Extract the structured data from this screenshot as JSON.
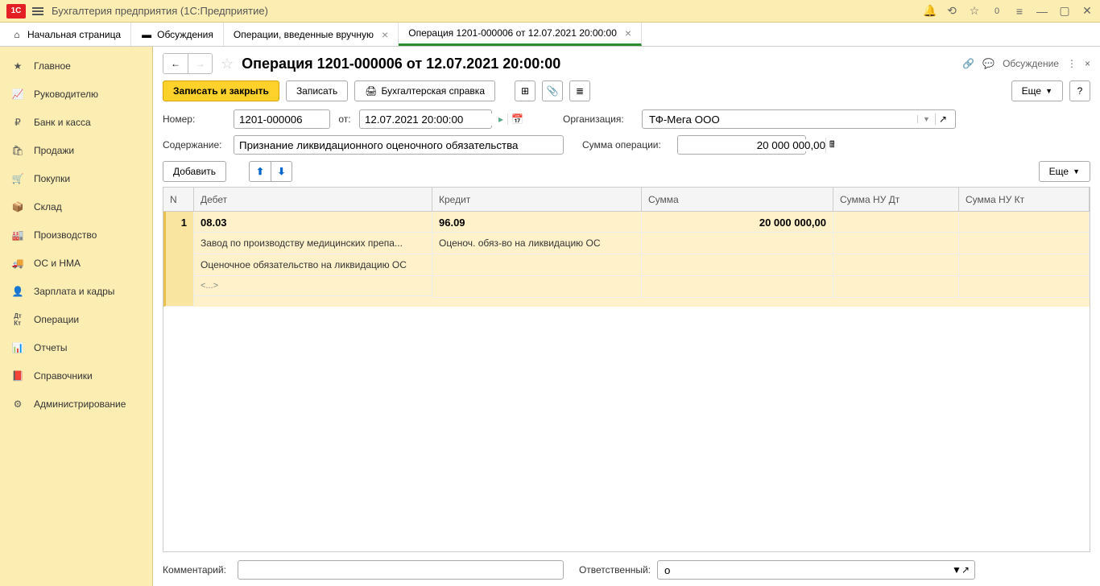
{
  "app": {
    "title": "Бухгалтерия предприятия  (1С:Предприятие)"
  },
  "tabs": [
    {
      "label": "Начальная страница",
      "closable": false
    },
    {
      "label": "Обсуждения",
      "closable": false
    },
    {
      "label": "Операции, введенные вручную",
      "closable": true
    },
    {
      "label": "Операция 1201-000006 от 12.07.2021 20:00:00",
      "closable": true,
      "active": true
    }
  ],
  "sidebar": {
    "items": [
      {
        "label": "Главное"
      },
      {
        "label": "Руководителю"
      },
      {
        "label": "Банк и касса"
      },
      {
        "label": "Продажи"
      },
      {
        "label": "Покупки"
      },
      {
        "label": "Склад"
      },
      {
        "label": "Производство"
      },
      {
        "label": "ОС и НМА"
      },
      {
        "label": "Зарплата и кадры"
      },
      {
        "label": "Операции"
      },
      {
        "label": "Отчеты"
      },
      {
        "label": "Справочники"
      },
      {
        "label": "Администрирование"
      }
    ]
  },
  "header": {
    "title": "Операция 1201-000006 от 12.07.2021 20:00:00",
    "discuss": "Обсуждение"
  },
  "toolbar": {
    "save_close": "Записать и закрыть",
    "save": "Записать",
    "report": "Бухгалтерская справка",
    "more": "Еще"
  },
  "form": {
    "number_label": "Номер:",
    "number": "1201-000006",
    "ot_label": "от:",
    "date": "12.07.2021 20:00:00",
    "org_label": "Организация:",
    "org": "ТФ-Мега ООО",
    "sod_label": "Содержание:",
    "sod": "Признание ликвидационного оценочного обязательства",
    "sum_label": "Сумма операции:",
    "sum": "20 000 000,00"
  },
  "table_toolbar": {
    "add": "Добавить",
    "more": "Еще"
  },
  "table": {
    "columns": {
      "n": "N",
      "debit": "Дебет",
      "credit": "Кредит",
      "sum": "Сумма",
      "nud": "Сумма НУ Дт",
      "nuk": "Сумма НУ Кт"
    },
    "row": {
      "n": "1",
      "debit_acc": "08.03",
      "credit_acc": "96.09",
      "sum": "20 000 000,00",
      "debit_sub1": "Завод по производству медицинских препа...",
      "debit_sub2": "Оценочное обязательство на ликвидацию ОС",
      "debit_sub3": "<...>",
      "credit_sub1": "Оценоч. обяз-во на ликвидацию ОС"
    }
  },
  "bottom": {
    "comment_label": "Комментарий:",
    "comment": "",
    "resp_label": "Ответственный:",
    "resp": "о"
  }
}
